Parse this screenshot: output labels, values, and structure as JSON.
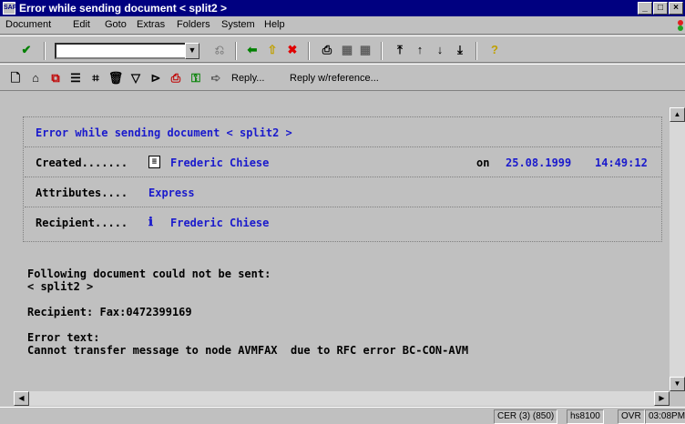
{
  "window": {
    "title": "Error while sending document < split2 >",
    "icon": "sap-icon"
  },
  "menubar": {
    "items": [
      "Document",
      "Edit",
      "Goto",
      "Extras",
      "Folders",
      "System",
      "Help"
    ]
  },
  "toolbar1": {
    "command_value": ""
  },
  "toolbar2": {
    "reply_label": "Reply...",
    "reply_ref_label": "Reply w/reference..."
  },
  "header": {
    "title": "Error while sending document < split2 >",
    "created_label": "Created.......",
    "created_by": "Frederic Chiese",
    "on_label": "on",
    "date": "25.08.1999",
    "time": "14:49:12",
    "attributes_label": "Attributes....",
    "attributes_value": "Express",
    "recipient_label": "Recipient.....",
    "recipient_value": "Frederic Chiese"
  },
  "body": {
    "line1": "Following document could not be sent:",
    "line2": "< split2 >",
    "line3": "Recipient: Fax:0472399169",
    "line4": "Error text:",
    "line5": "Cannot transfer message to node AVMFAX  due to RFC error BC-CON-AVM"
  },
  "statusbar": {
    "system": "CER (3) (850)",
    "host": "hs8100",
    "mode": "OVR",
    "time": "03:08PM"
  },
  "colors": {
    "titlebar": "#000080",
    "link_blue": "#1a1acc",
    "background": "#c0c0c0"
  }
}
